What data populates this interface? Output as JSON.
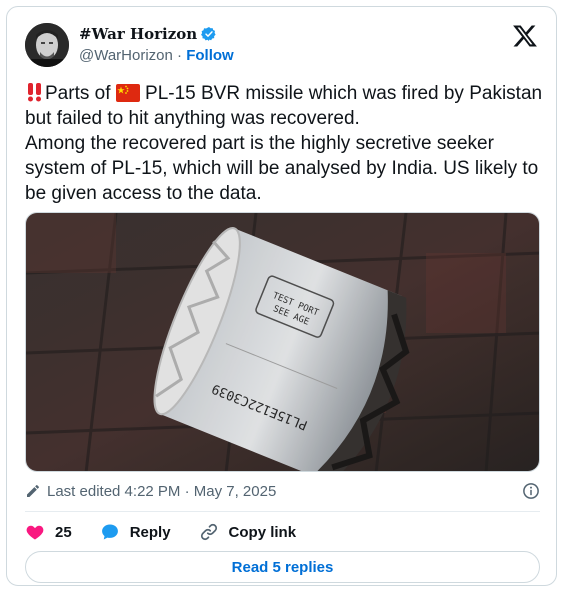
{
  "author": {
    "display_name": "#War Horizon",
    "handle": "@WarHorizon",
    "separator": " · ",
    "follow_label": "Follow"
  },
  "tweet": {
    "text_part1": "Parts of ",
    "text_part2": " PL-15 BVR missile which was fired by Pakistan but failed to hit anything was recovered.",
    "text_part3": "Among the recovered part is the highly secretive seeker system of PL-15, which will be analysed by India. US likely to be given access to the data.",
    "image_markings": {
      "stencil_line1": "TEST PORT",
      "stencil_line2": "SEE AGE",
      "serial": "PL15E122C3039"
    }
  },
  "meta": {
    "edited_label": "Last edited 4:22 PM · May 7, 2025"
  },
  "actions": {
    "like_count": "25",
    "reply_label": "Reply",
    "copy_link_label": "Copy link"
  },
  "footer": {
    "read_replies_label": "Read 5 replies"
  },
  "colors": {
    "link_blue": "#006fd6",
    "like_pink": "#f91880",
    "reply_blue": "#1d9bf0",
    "verified_blue": "#1d9bf0",
    "border": "#cfd9de"
  },
  "icons": [
    "verified-badge-icon",
    "x-logo-icon",
    "double-exclamation-icon",
    "china-flag-icon",
    "pencil-icon",
    "info-icon",
    "heart-icon",
    "reply-bubble-icon",
    "link-icon"
  ]
}
